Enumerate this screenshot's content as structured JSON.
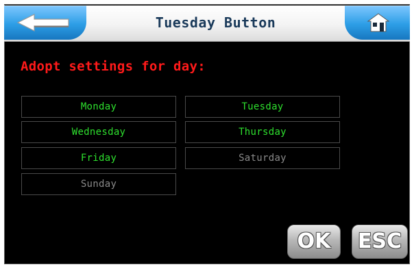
{
  "header": {
    "title": "Tuesday Button",
    "back_icon": "back-arrow-icon",
    "home_icon": "home-icon"
  },
  "main": {
    "heading": "Adopt settings for day:",
    "days": [
      {
        "label": "Monday",
        "active": true
      },
      {
        "label": "Tuesday",
        "active": true
      },
      {
        "label": "Wednesday",
        "active": true
      },
      {
        "label": "Thursday",
        "active": true
      },
      {
        "label": "Friday",
        "active": true
      },
      {
        "label": "Saturday",
        "active": false
      },
      {
        "label": "Sunday",
        "active": false
      }
    ]
  },
  "actions": {
    "ok_label": "OK",
    "esc_label": "ESC"
  },
  "colors": {
    "heading": "#ff1a1a",
    "day_active": "#2ee02e",
    "day_inactive": "#8a8a8a",
    "header_accent": "#2d9ee6"
  }
}
